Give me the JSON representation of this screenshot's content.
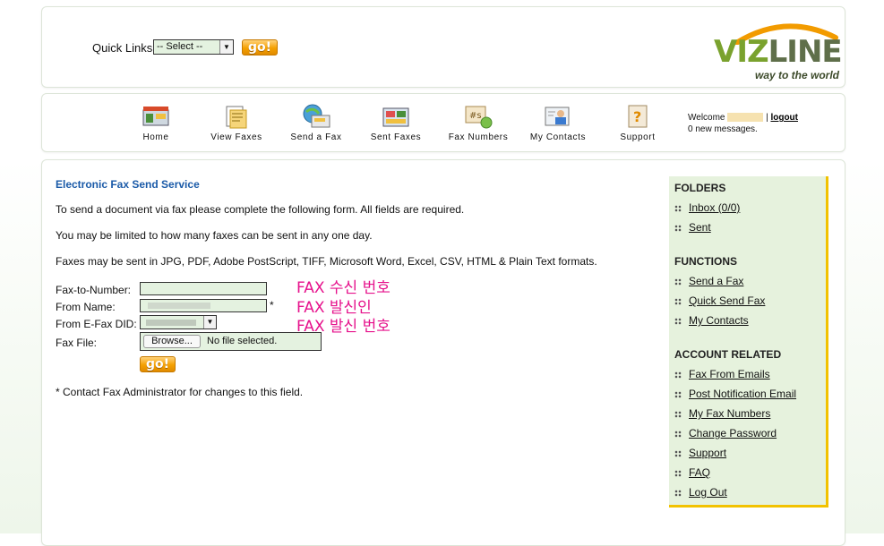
{
  "quick_links": {
    "label": "Quick Links:",
    "selected": "-- Select --",
    "go_label": "go!"
  },
  "logo": {
    "part1": "VIZ",
    "part2": "LINE",
    "tagline": "way to the world"
  },
  "nav": [
    {
      "label": "Home",
      "icon": "home-icon"
    },
    {
      "label": "View Faxes",
      "icon": "view-faxes-icon"
    },
    {
      "label": "Send a Fax",
      "icon": "send-fax-icon"
    },
    {
      "label": "Sent Faxes",
      "icon": "sent-faxes-icon"
    },
    {
      "label": "Fax Numbers",
      "icon": "fax-numbers-icon"
    },
    {
      "label": "My Contacts",
      "icon": "contacts-icon"
    },
    {
      "label": "Support",
      "icon": "support-icon"
    }
  ],
  "welcome": {
    "prefix": "Welcome",
    "separator": "|",
    "logout": "logout",
    "messages": "0 new messages."
  },
  "main": {
    "title": "Electronic Fax Send Service",
    "para1": "To send a document via fax please complete the following form. All fields are required.",
    "para2": "You may be limited to how many faxes can be sent in any one day.",
    "para3": "Faxes may be sent in JPG, PDF, Adobe PostScript, TIFF, Microsoft Word, Excel, CSV, HTML & Plain Text formats.",
    "form": {
      "fax_to_label": "Fax-to-Number:",
      "from_name_label": "From Name:",
      "from_did_label": "From E-Fax DID:",
      "fax_file_label": "Fax File:",
      "required_mark": "*",
      "browse_label": "Browse...",
      "no_file": "No file selected.",
      "go_label": "go!"
    },
    "note": "* Contact Fax Administrator for changes to this field.",
    "annotations": [
      "FAX 수신 번호",
      "FAX 발신인",
      "FAX 발신 번호"
    ]
  },
  "sidebar": {
    "folders_title": "FOLDERS",
    "folders": [
      "Inbox (0/0)",
      "Sent"
    ],
    "functions_title": "FUNCTIONS",
    "functions": [
      "Send a Fax",
      "Quick Send Fax",
      "My Contacts"
    ],
    "account_title": "ACCOUNT RELATED",
    "account": [
      "Fax From Emails",
      "Post Notification Email",
      "My Fax Numbers",
      "Change Password",
      "Support",
      "FAQ",
      "Log Out"
    ]
  },
  "colors": {
    "accent_blue": "#1a5aa8",
    "annotation_pink": "#e6128c",
    "sidebar_bg": "#e6f2dd",
    "sidebar_border": "#f2c200",
    "go_orange": "#f5a000"
  }
}
